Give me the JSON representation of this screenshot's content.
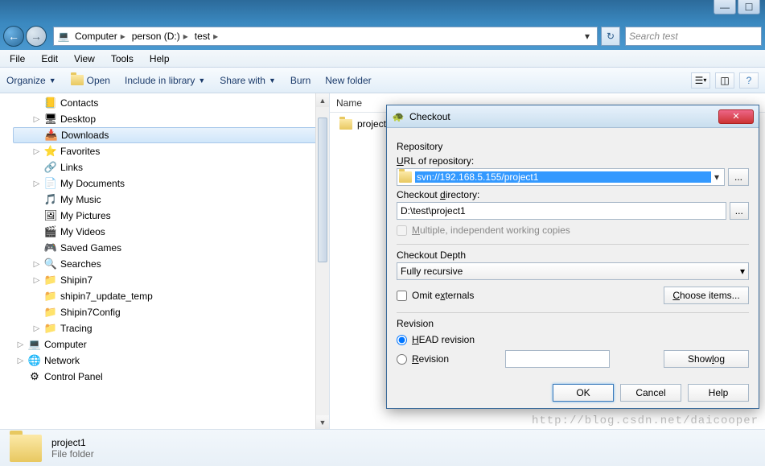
{
  "window_controls": {
    "min": "—",
    "max": "☐"
  },
  "breadcrumb": [
    "Computer",
    "person (D:)",
    "test"
  ],
  "search": {
    "placeholder": "Search test"
  },
  "menubar": [
    "File",
    "Edit",
    "View",
    "Tools",
    "Help"
  ],
  "cmdbar": {
    "organize": "Organize",
    "open": "Open",
    "include": "Include in library",
    "share": "Share with",
    "burn": "Burn",
    "newfolder": "New folder"
  },
  "tree": [
    {
      "level": 1,
      "exp": "",
      "icon": "📒",
      "label": "Contacts"
    },
    {
      "level": 1,
      "exp": "▷",
      "icon": "🖥",
      "label": "Desktop"
    },
    {
      "level": 1,
      "exp": "",
      "icon": "📥",
      "label": "Downloads",
      "selected": true
    },
    {
      "level": 1,
      "exp": "▷",
      "icon": "⭐",
      "label": "Favorites"
    },
    {
      "level": 1,
      "exp": "",
      "icon": "🔗",
      "label": "Links"
    },
    {
      "level": 1,
      "exp": "▷",
      "icon": "📄",
      "label": "My Documents"
    },
    {
      "level": 1,
      "exp": "",
      "icon": "🎵",
      "label": "My Music"
    },
    {
      "level": 1,
      "exp": "",
      "icon": "🖼",
      "label": "My Pictures"
    },
    {
      "level": 1,
      "exp": "",
      "icon": "🎬",
      "label": "My Videos"
    },
    {
      "level": 1,
      "exp": "",
      "icon": "🎮",
      "label": "Saved Games"
    },
    {
      "level": 1,
      "exp": "▷",
      "icon": "🔍",
      "label": "Searches"
    },
    {
      "level": 1,
      "exp": "▷",
      "icon": "📁",
      "label": "Shipin7"
    },
    {
      "level": 1,
      "exp": "",
      "icon": "📁",
      "label": "shipin7_update_temp"
    },
    {
      "level": 1,
      "exp": "",
      "icon": "📁",
      "label": "Shipin7Config"
    },
    {
      "level": 1,
      "exp": "▷",
      "icon": "📁",
      "label": "Tracing"
    },
    {
      "level": 0,
      "exp": "▷",
      "icon": "💻",
      "label": "Computer",
      "sys": true
    },
    {
      "level": 0,
      "exp": "▷",
      "icon": "🌐",
      "label": "Network",
      "sys": true
    },
    {
      "level": 0,
      "exp": "",
      "icon": "⚙",
      "label": "Control Panel",
      "sys": true
    }
  ],
  "columns": {
    "name": "Name"
  },
  "files": [
    {
      "name": "project1"
    }
  ],
  "details": {
    "name": "project1",
    "type": "File folder"
  },
  "dialog": {
    "title": "Checkout",
    "section_repo": "Repository",
    "url_label": "URL of repository:",
    "url_value": "svn://192.168.5.155/project1",
    "dir_label": "Checkout directory:",
    "dir_value": "D:\\test\\project1",
    "multi_label": "Multiple, independent working copies",
    "depth_label": "Checkout Depth",
    "depth_value": "Fully recursive",
    "omit_label": "Omit externals",
    "choose_label": "Choose items...",
    "rev_section": "Revision",
    "head_label": "HEAD revision",
    "rev_label": "Revision",
    "showlog_label": "Show log",
    "ok": "OK",
    "cancel": "Cancel",
    "help": "Help"
  },
  "watermark": "http://blog.csdn.net/daicooper"
}
